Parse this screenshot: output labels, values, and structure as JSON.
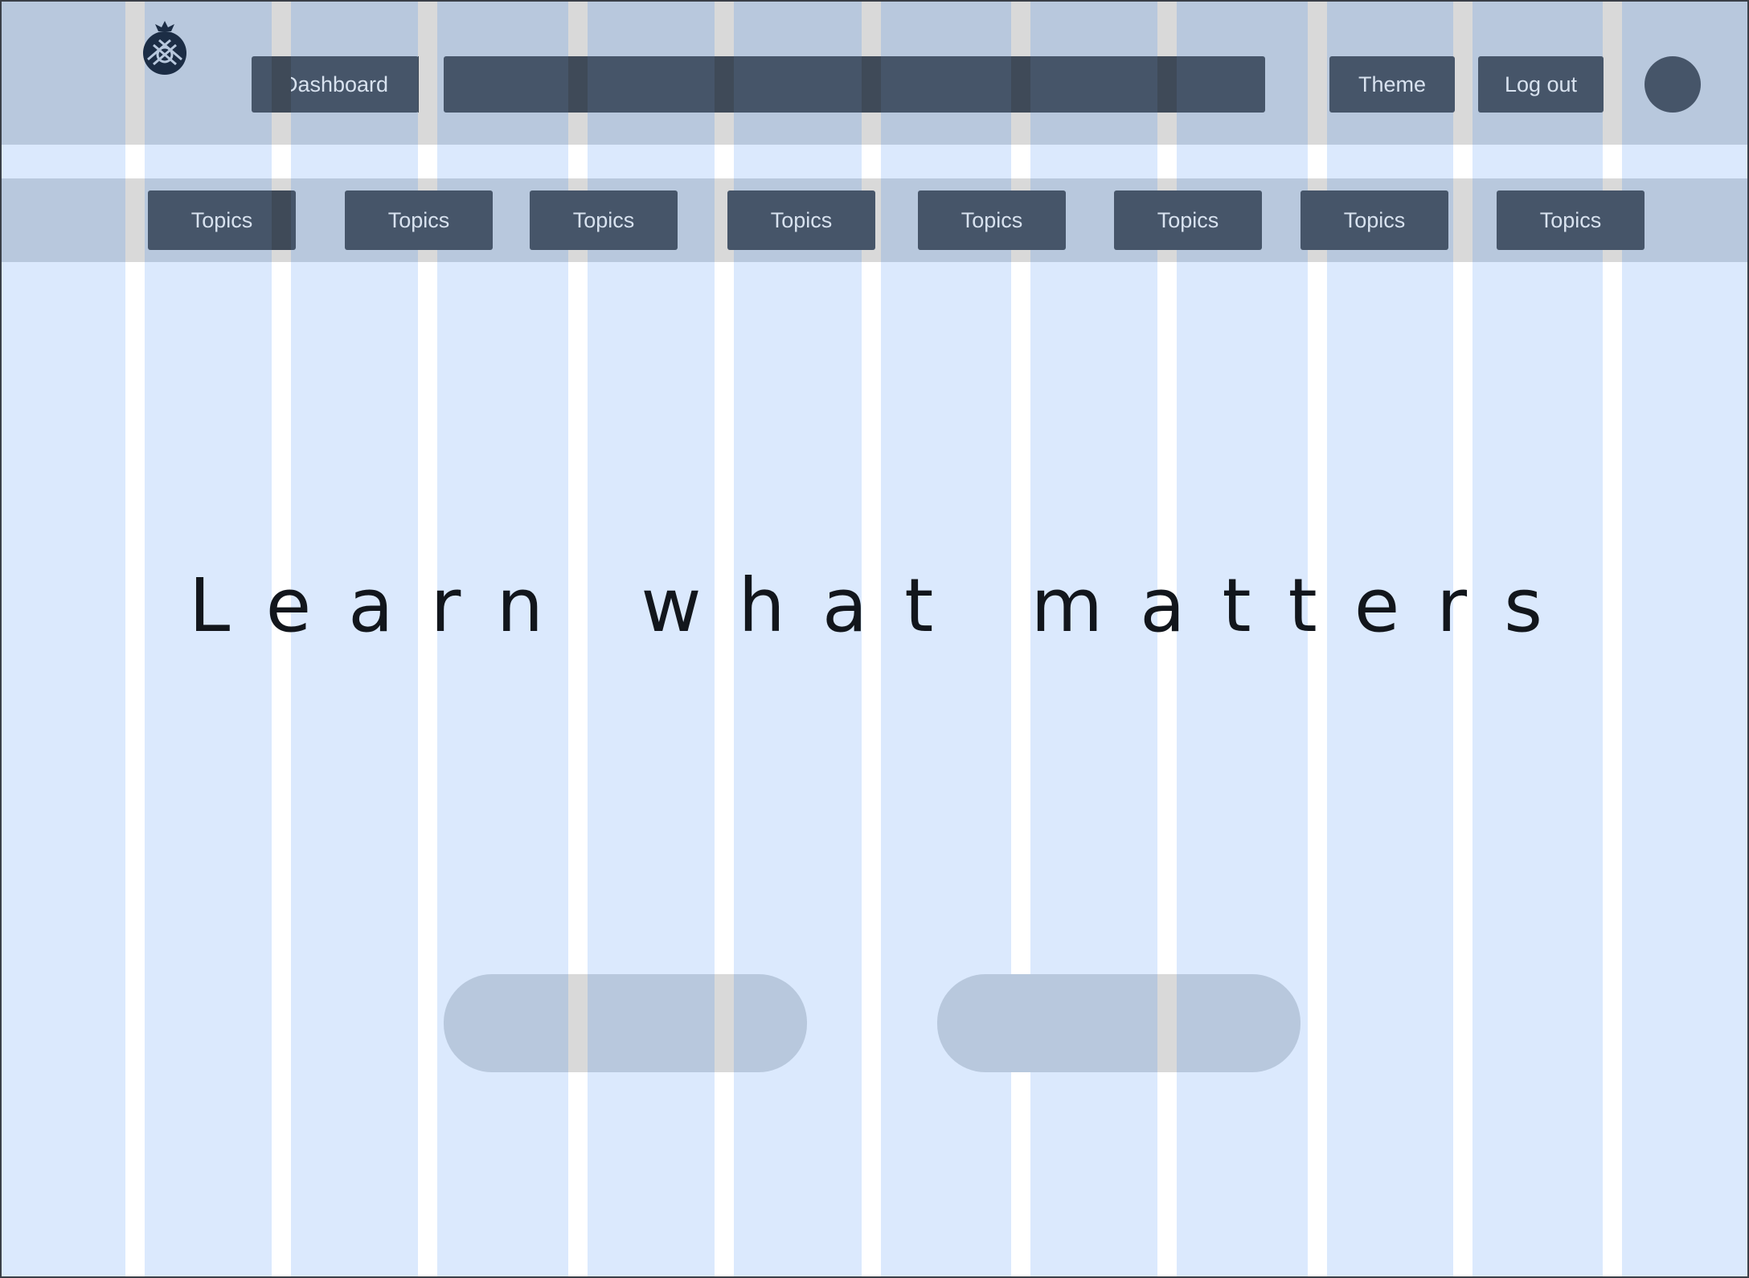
{
  "header": {
    "logo_icon": "pineapple-logo-icon",
    "dashboard_label": "Dashboard",
    "search_placeholder": "",
    "theme_label": "Theme",
    "logout_label": "Log out",
    "avatar_icon": "user-avatar"
  },
  "topics": [
    {
      "label": "Topics"
    },
    {
      "label": "Topics"
    },
    {
      "label": "Topics"
    },
    {
      "label": "Topics"
    },
    {
      "label": "Topics"
    },
    {
      "label": "Topics"
    },
    {
      "label": "Topics"
    },
    {
      "label": "Topics"
    }
  ],
  "hero": {
    "title": "Learn what matters",
    "primary_button_label": "",
    "secondary_button_label": ""
  },
  "colors": {
    "background": "#dbe9fd",
    "band": "#b8c8dd",
    "button_dark": "#465569",
    "gutter": "#ffffff",
    "gutter_overlay": "#d9d9d9",
    "text_dark": "#12161c"
  }
}
